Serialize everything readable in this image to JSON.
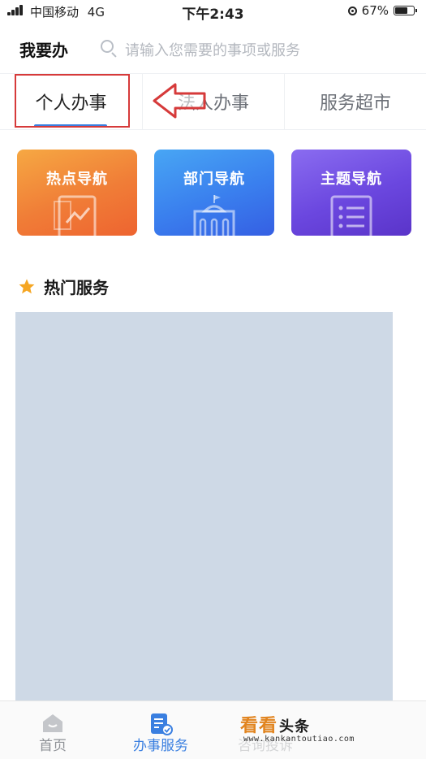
{
  "status_bar": {
    "carrier": "中国移动",
    "network": "4G",
    "time": "下午2:43",
    "battery": "67%",
    "battery_level": 0.67
  },
  "header": {
    "title": "我要办",
    "search_placeholder": "请输入您需要的事项或服务"
  },
  "tabs": [
    {
      "label": "个人办事",
      "active": true
    },
    {
      "label": "法人办事",
      "active": false
    },
    {
      "label": "服务超市",
      "active": false
    }
  ],
  "nav_cards": [
    {
      "label": "热点导航",
      "icon": "chart-document-icon",
      "color": "#f07d37"
    },
    {
      "label": "部门导航",
      "icon": "government-building-icon",
      "color": "#3a7fee"
    },
    {
      "label": "主题导航",
      "icon": "list-document-icon",
      "color": "#6b47df"
    }
  ],
  "hot_services": {
    "title": "热门服务",
    "icon": "star-icon"
  },
  "bottom_nav": [
    {
      "label": "首页",
      "icon": "home-icon",
      "active": false
    },
    {
      "label": "办事服务",
      "icon": "service-document-icon",
      "active": true
    },
    {
      "label": "咨询投诉",
      "icon": "consult-icon",
      "active": false
    }
  ],
  "watermark": {
    "logo_main": "看看",
    "logo_sub": "头条",
    "url": "www.kankantoutiao.com"
  },
  "colors": {
    "accent": "#3a7fe0",
    "annotation_red": "#d63a3a",
    "placeholder_block": "#ced9e6"
  }
}
